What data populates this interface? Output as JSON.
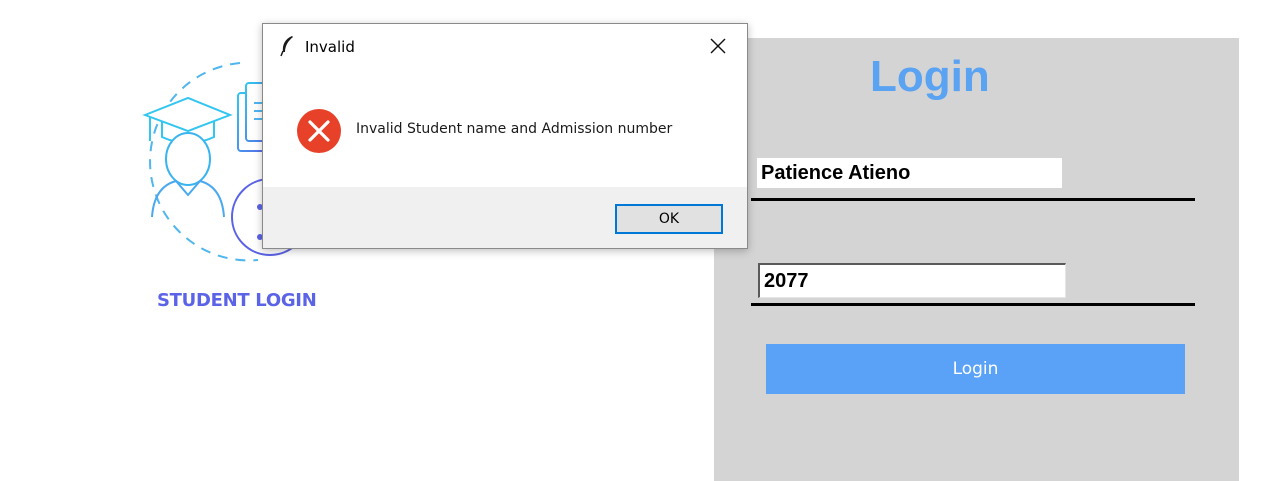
{
  "brand": {
    "label": "STUDENT LOGIN"
  },
  "login": {
    "title": "Login",
    "student_name": "Patience Atieno",
    "admission_number": "2077",
    "button_label": "Login"
  },
  "dialog": {
    "title": "Invalid",
    "message": "Invalid Student name and Admission number",
    "ok_label": "OK",
    "icons": {
      "title_icon": "feather-icon",
      "status_icon": "error-icon",
      "close": "close-icon"
    }
  },
  "colors": {
    "accent_blue": "#5aa2f2",
    "brand_purple": "#5b63e6",
    "panel_gray": "#d4d4d4",
    "error_red": "#e8412a"
  }
}
